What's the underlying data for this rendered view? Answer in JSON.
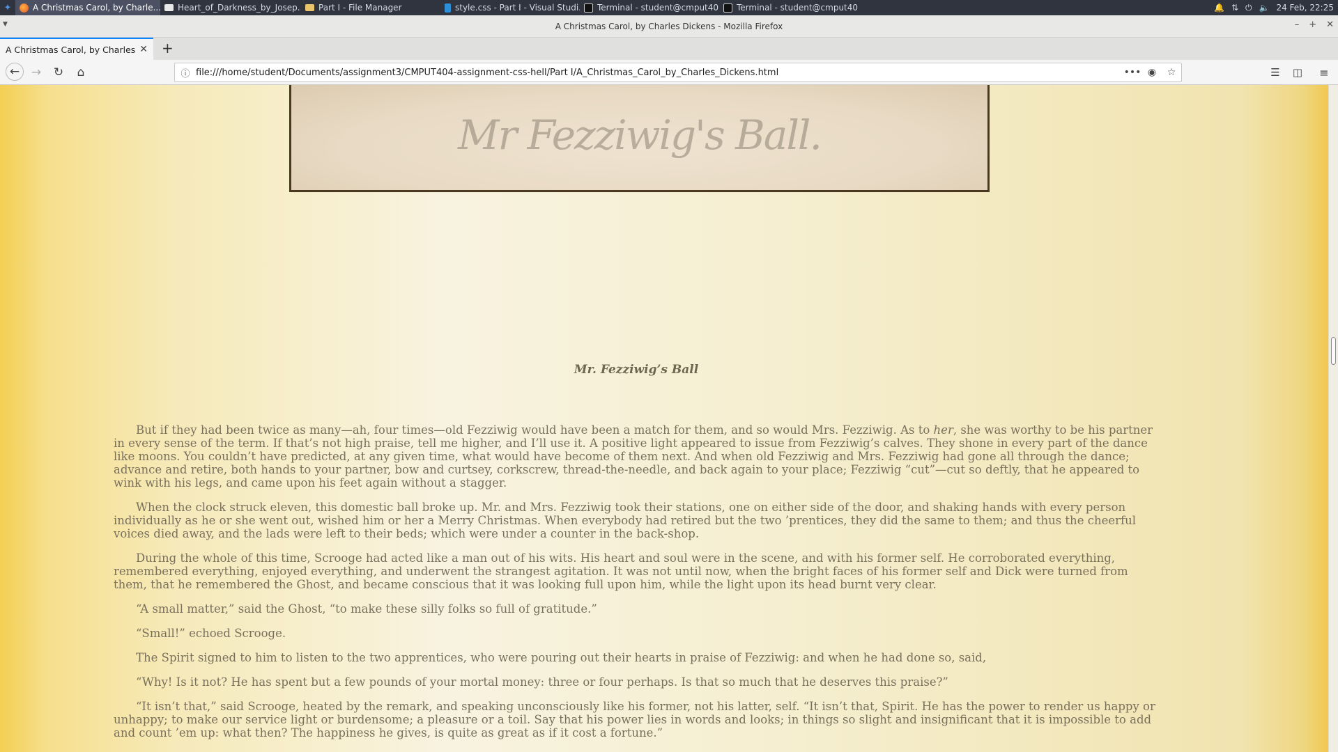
{
  "taskbar": {
    "tasks": [
      {
        "label": "A Christmas Carol, by Charle...",
        "icon": "firefox-icon"
      },
      {
        "label": "Heart_of_Darkness_by_Josep...",
        "icon": "document-icon"
      },
      {
        "label": "Part I - File Manager",
        "icon": "folder-icon"
      },
      {
        "label": "style.css - Part I - Visual Studi...",
        "icon": "vscode-icon"
      },
      {
        "label": "Terminal - student@cmput40...",
        "icon": "terminal-icon"
      },
      {
        "label": "Terminal - student@cmput40...",
        "icon": "terminal-icon"
      }
    ],
    "clock": "24 Feb, 22:25"
  },
  "window": {
    "title": "A Christmas Carol, by Charles Dickens - Mozilla Firefox"
  },
  "tabs": {
    "active_label": "A Christmas Carol, by Charles Dic"
  },
  "navbar": {
    "url": "file:///home/student/Documents/assignment3/CMPUT404-assignment-css-hell/Part I/A_Christmas_Carol_by_Charles_Dickens.html",
    "page_actions_label": "•••"
  },
  "page": {
    "plate_text": "Mr Fezziwig's Ball.",
    "caption": "Mr. Fezziwig’s Ball",
    "p1_a": "But if they had been twice as many—ah, four times—old Fezziwig would have been a match for them, and so would Mrs. Fezziwig. As to ",
    "p1_em": "her",
    "p1_b": ", she was worthy to be his partner in every sense of the term. If that’s not high praise, tell me higher, and I’ll use it. A positive light appeared to issue from Fezziwig’s calves. They shone in every part of the dance like moons. You couldn’t have predicted, at any given time, what would have become of them next. And when old Fezziwig and Mrs. Fezziwig had gone all through the dance; advance and retire, both hands to your partner, bow and curtsey, corkscrew, thread-the-needle, and back again to your place; Fezziwig “cut”—cut so deftly, that he appeared to wink with his legs, and came upon his feet again without a stagger.",
    "p2": "When the clock struck eleven, this domestic ball broke up. Mr. and Mrs. Fezziwig took their stations, one on either side of the door, and shaking hands with every person individually as he or she went out, wished him or her a Merry Christmas. When everybody had retired but the two ’prentices, they did the same to them; and thus the cheerful voices died away, and the lads were left to their beds; which were under a counter in the back-shop.",
    "p3": "During the whole of this time, Scrooge had acted like a man out of his wits. His heart and soul were in the scene, and with his former self. He corroborated everything, remembered everything, enjoyed everything, and underwent the strangest agitation. It was not until now, when the bright faces of his former self and Dick were turned from them, that he remembered the Ghost, and became conscious that it was looking full upon him, while the light upon its head burnt very clear.",
    "p4": "“A small matter,” said the Ghost, “to make these silly folks so full of gratitude.”",
    "p5": "“Small!” echoed Scrooge.",
    "p6": "The Spirit signed to him to listen to the two apprentices, who were pouring out their hearts in praise of Fezziwig: and when he had done so, said,",
    "p7": "“Why! Is it not? He has spent but a few pounds of your mortal money: three or four perhaps. Is that so much that he deserves this praise?”",
    "p8": "“It isn’t that,” said Scrooge, heated by the remark, and speaking unconsciously like his former, not his latter, self. “It isn’t that, Spirit. He has the power to render us happy or unhappy; to make our service light or burdensome; a pleasure or a toil. Say that his power lies in words and looks; in things so slight and insignificant that it is impossible to add and count ’em up: what then? The happiness he gives, is quite as great as if it cost a fortune.”"
  },
  "colors": {
    "taskbar_bg": "#2f343f",
    "tab_accent": "#0a84ff",
    "page_edge_gold": "#f3cf54",
    "text_color": "#79705c"
  }
}
